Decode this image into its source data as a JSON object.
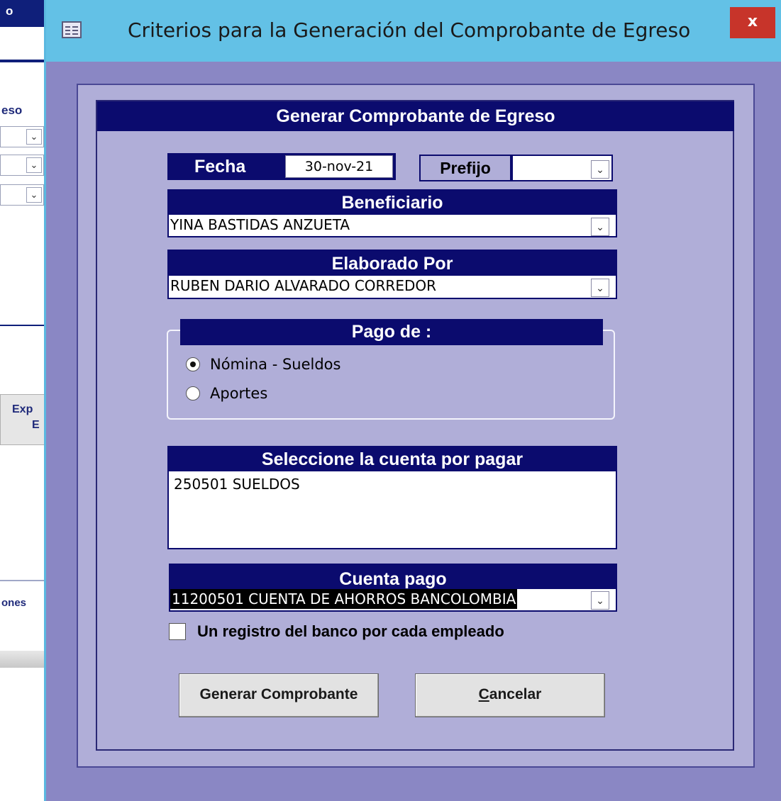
{
  "background": {
    "top_text": "o",
    "side_text_1": "eso",
    "side_button_text_1": "Exp",
    "side_button_text_2": "E",
    "side_text_2": "ones"
  },
  "dialog": {
    "title": "Criterios para la Generación del Comprobante de Egreso",
    "close_label": "x",
    "header": "Generar Comprobante de Egreso",
    "fecha": {
      "label": "Fecha",
      "value": "30-nov-21"
    },
    "prefijo": {
      "label": "Prefijo",
      "value": ""
    },
    "beneficiario": {
      "label": "Beneficiario",
      "value": "YINA BASTIDAS ANZUETA"
    },
    "elaborado_por": {
      "label": "Elaborado Por",
      "value": "RUBEN DARIO ALVARADO CORREDOR"
    },
    "pago_de": {
      "label": "Pago de :",
      "options": [
        {
          "label": "Nómina - Sueldos",
          "selected": true
        },
        {
          "label": "Aportes",
          "selected": false
        }
      ]
    },
    "cuenta_por_pagar": {
      "label": "Seleccione la cuenta por pagar",
      "items": [
        "250501 SUELDOS"
      ]
    },
    "cuenta_pago": {
      "label": "Cuenta pago",
      "value": "11200501 CUENTA DE AHORROS BANCOLOMBIA"
    },
    "checkbox_label": "Un registro del banco por cada empleado",
    "generate_button": "Generar Comprobante",
    "cancel_button": {
      "accel": "C",
      "rest": "ancelar"
    },
    "dropdown_arrow": "⌄"
  },
  "colors": {
    "titlebar": "#63c1e6",
    "window_bg": "#8a87c4",
    "panel_bg": "#b0aed8",
    "dark_navy": "#0b0b6e",
    "close_red": "#c7342a"
  }
}
